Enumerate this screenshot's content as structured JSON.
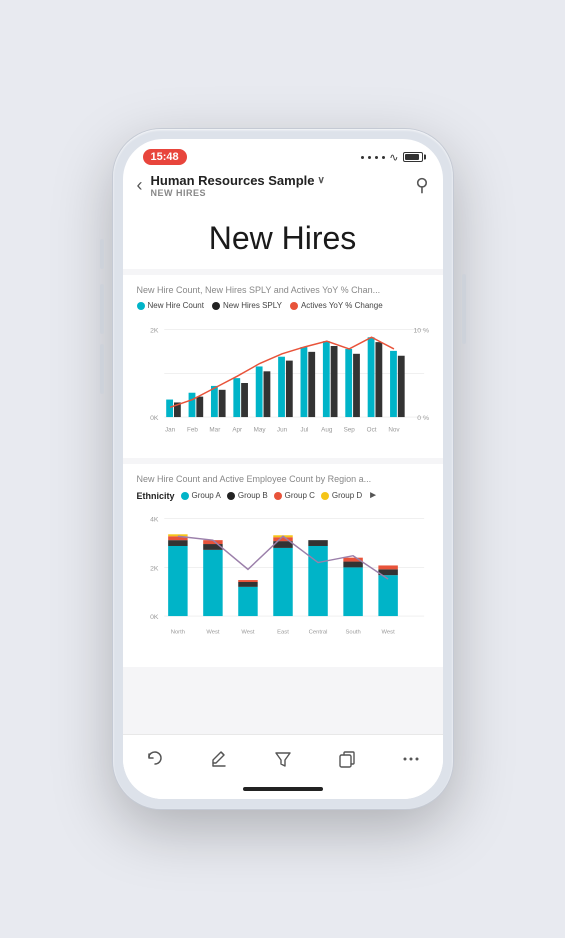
{
  "status": {
    "time": "15:48",
    "dots": [
      "•",
      "•",
      "•",
      "•"
    ],
    "wifi": "wifi",
    "battery": "battery"
  },
  "nav": {
    "back_label": "‹",
    "title": "Human Resources Sample",
    "chevron": "∨",
    "subtitle": "NEW HIRES",
    "search_icon": "search"
  },
  "page": {
    "title": "New Hires"
  },
  "chart1": {
    "title": "New Hire Count, New Hires SPLY and Actives YoY % Chan...",
    "legend": [
      {
        "label": "New Hire Count",
        "color": "#00b4c8"
      },
      {
        "label": "New Hires SPLY",
        "color": "#222222"
      },
      {
        "label": "Actives YoY % Change",
        "color": "#e8533a"
      }
    ],
    "x_labels": [
      "Jan",
      "Feb",
      "Mar",
      "Apr",
      "May",
      "Jun",
      "Jul",
      "Aug",
      "Sep",
      "Oct",
      "Nov"
    ],
    "y_left_labels": [
      "2K",
      "0K"
    ],
    "y_right_labels": [
      "10 %",
      "0 %"
    ]
  },
  "chart2": {
    "title": "New Hire Count and Active Employee Count by Region a...",
    "ethnicity_label": "Ethnicity",
    "legend": [
      {
        "label": "Group A",
        "color": "#00b4c8"
      },
      {
        "label": "Group B",
        "color": "#222222"
      },
      {
        "label": "Group C",
        "color": "#e8533a"
      },
      {
        "label": "Group D",
        "color": "#f5c518"
      }
    ],
    "x_labels": [
      "North",
      "West",
      "West",
      "East",
      "Central",
      "South",
      "West"
    ],
    "y_labels": [
      "4K",
      "2K",
      "0K"
    ]
  },
  "toolbar": {
    "items": [
      {
        "icon": "↩",
        "name": "undo"
      },
      {
        "icon": "✏",
        "name": "edit"
      },
      {
        "icon": "⊘",
        "name": "filter"
      },
      {
        "icon": "⧉",
        "name": "copy"
      },
      {
        "icon": "…",
        "name": "more"
      }
    ]
  }
}
